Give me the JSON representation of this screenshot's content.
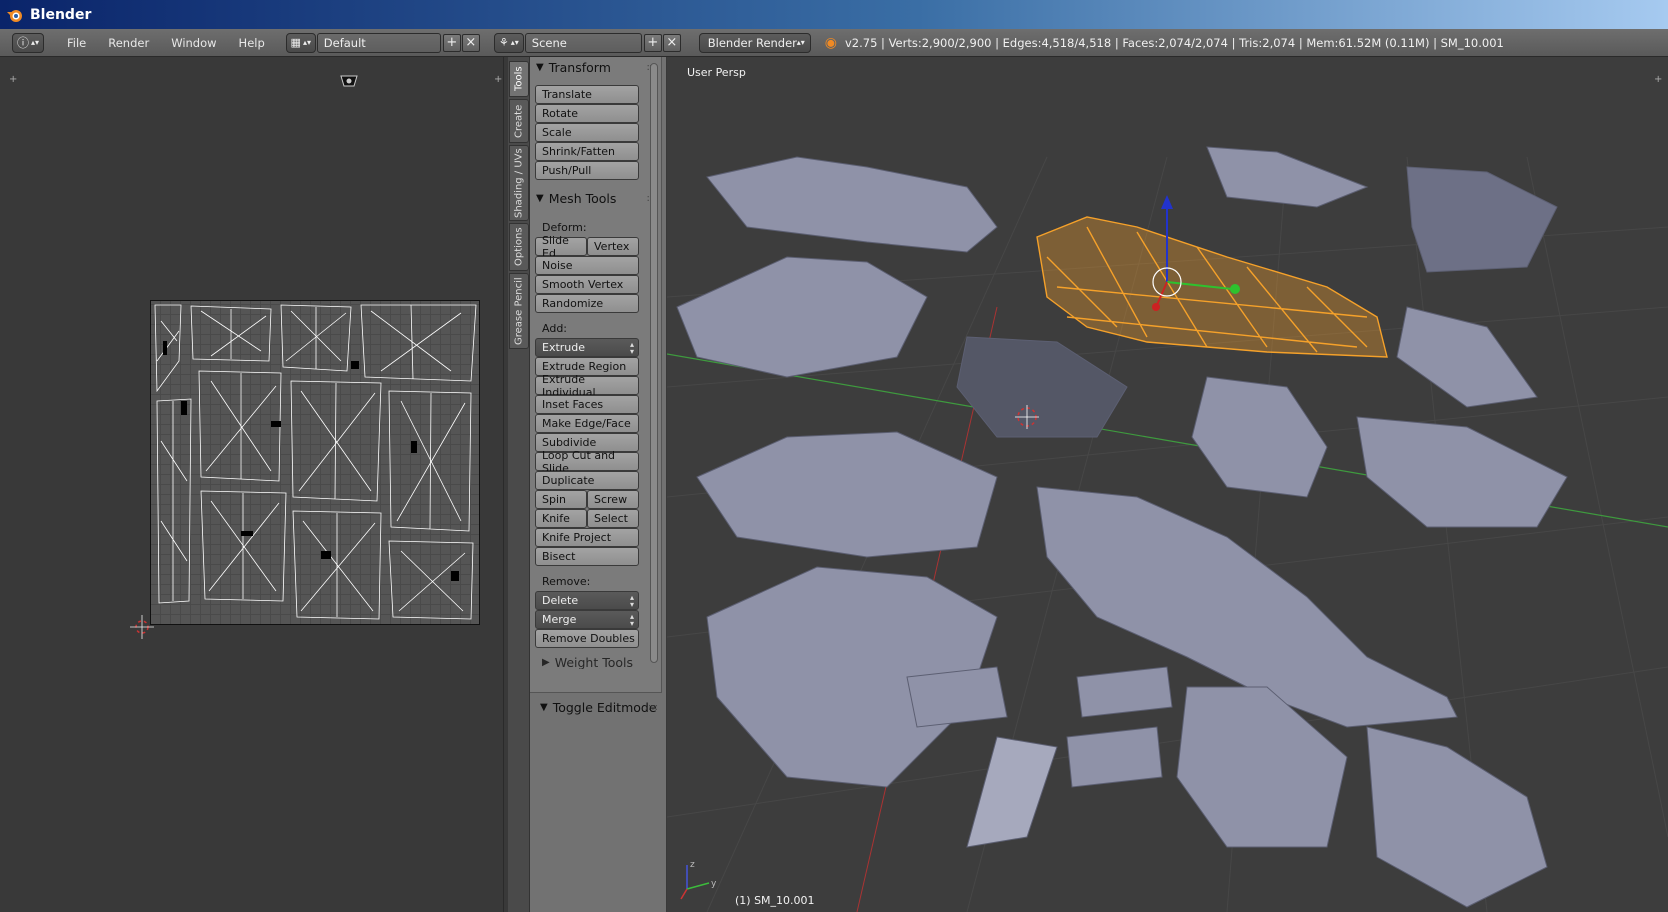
{
  "window": {
    "title": "Blender"
  },
  "info_header": {
    "menus": [
      "File",
      "Render",
      "Window",
      "Help"
    ],
    "screen_layout": "Default",
    "scene": "Scene",
    "render_engine": "Blender Render",
    "stats": "v2.75 | Verts:2,900/2,900 | Edges:4,518/4,518 | Faces:2,074/2,074 | Tris:2,074 | Mem:61.52M (0.11M) | SM_10.001"
  },
  "tool_tabs": [
    "Tools",
    "Create",
    "Shading / UVs",
    "Options",
    "Grease Pencil"
  ],
  "tool_shelf": {
    "transform": {
      "title": "Transform",
      "buttons": [
        "Translate",
        "Rotate",
        "Scale",
        "Shrink/Fatten",
        "Push/Pull"
      ]
    },
    "mesh_tools": {
      "title": "Mesh Tools",
      "deform_label": "Deform:",
      "slide_edge": "Slide Ed",
      "vertex": "Vertex",
      "noise": "Noise",
      "smooth_vertex": "Smooth Vertex",
      "randomize": "Randomize",
      "add_label": "Add:",
      "extrude": "Extrude",
      "extrude_region": "Extrude Region",
      "extrude_individual": "Extrude Individual",
      "inset_faces": "Inset Faces",
      "make_edge_face": "Make Edge/Face",
      "subdivide": "Subdivide",
      "loop_cut": "Loop Cut and Slide",
      "duplicate": "Duplicate",
      "spin": "Spin",
      "screw": "Screw",
      "knife": "Knife",
      "select": "Select",
      "knife_project": "Knife Project",
      "bisect": "Bisect",
      "remove_label": "Remove:",
      "delete": "Delete",
      "merge": "Merge",
      "remove_doubles": "Remove Doubles",
      "weight_tools": "Weight Tools"
    },
    "toggle_editmode": "Toggle Editmode"
  },
  "viewport": {
    "view_label": "User Persp",
    "object_label": "(1) SM_10.001",
    "selection_color": "#f5a12a",
    "grid_x_color": "#b83b3b",
    "grid_y_color": "#3ea03e"
  }
}
